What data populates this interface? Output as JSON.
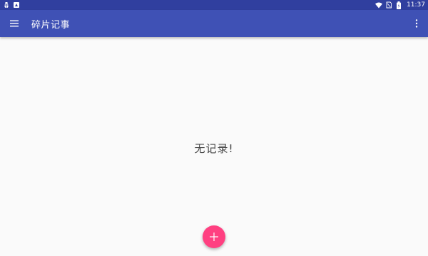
{
  "status_bar": {
    "time": "11:37",
    "left_icons": [
      "bug-icon",
      "android-notification-icon"
    ],
    "right_icons": [
      "wifi-icon",
      "sim-no-signal-icon",
      "battery-icon"
    ]
  },
  "app_bar": {
    "title": "碎片记事",
    "menu_icon": "hamburger-menu-icon",
    "overflow_icon": "more-vert-icon"
  },
  "content": {
    "empty_message": "无记录!"
  },
  "fab": {
    "icon": "plus-icon"
  },
  "colors": {
    "status_bar": "#303f9f",
    "app_bar": "#3f51b5",
    "background": "#fafafa",
    "fab": "#ff4081"
  }
}
